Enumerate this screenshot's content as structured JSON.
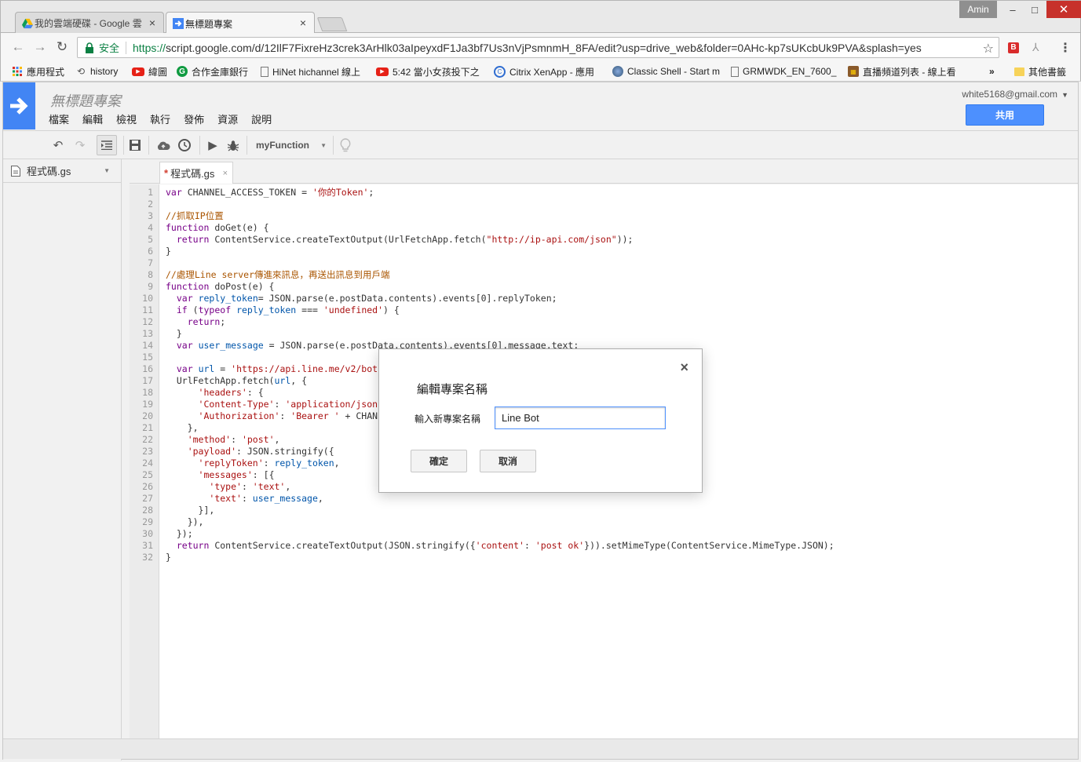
{
  "browser": {
    "tabs": [
      {
        "title": "我的雲端硬碟 - Google 雲",
        "close": "×"
      },
      {
        "title": "無標題專案",
        "close": "×"
      }
    ],
    "user_badge": "Amin",
    "window_buttons": {
      "minimize": "–",
      "maximize": "□",
      "close": "✕"
    },
    "secure_label": "安全",
    "url_scheme": "https://",
    "url_rest": "script.google.com/d/12IlF7FixreHz3crek3ArHlk03aIpeyxdF1Ja3bf7Us3nVjPsmnmH_8FA/edit?usp=drive_web&folder=0AHc-kp7sUKcbUk9PVA&splash=yes",
    "bookmarks": [
      {
        "label": "應用程式",
        "icon": "apps-grid-icon"
      },
      {
        "label": "history",
        "icon": "history-icon"
      },
      {
        "label": "緯圖",
        "icon": "youtube-icon"
      },
      {
        "label": "合作金庫銀行",
        "icon": "bank-icon"
      },
      {
        "label": "HiNet hichannel 線上",
        "icon": "page-icon"
      },
      {
        "label": "5:42 當小女孩投下之",
        "icon": "youtube-icon"
      },
      {
        "label": "Citrix XenApp - 應用",
        "icon": "citrix-icon"
      },
      {
        "label": "Classic Shell - Start m",
        "icon": "shell-icon"
      },
      {
        "label": "GRMWDK_EN_7600_",
        "icon": "page-icon"
      },
      {
        "label": "直播頻道列表 - 線上看",
        "icon": "tv-icon"
      }
    ],
    "bookmarks_more": "»",
    "other_bookmarks": "其他書籤"
  },
  "app": {
    "project_title": "無標題專案",
    "menu": [
      "檔案",
      "編輯",
      "檢視",
      "執行",
      "發佈",
      "資源",
      "說明"
    ],
    "account": "white5168@gmail.com",
    "share_label": "共用",
    "function_select": "myFunction",
    "file_name": "程式碼.gs",
    "tab_dirty": "*",
    "tab_name": "程式碼.gs",
    "tab_close": "×"
  },
  "code_lines": [
    "var CHANNEL_ACCESS_TOKEN = '你的Token';",
    "",
    "//抓取IP位置",
    "function doGet(e) {",
    "  return ContentService.createTextOutput(UrlFetchApp.fetch(\"http://ip-api.com/json\"));",
    "}",
    "",
    "//處理Line server傳進來訊息，再送出訊息到用戶端",
    "function doPost(e) {",
    "  var reply_token= JSON.parse(e.postData.contents).events[0].replyToken;",
    "  if (typeof reply_token === 'undefined') {",
    "    return;",
    "  }",
    "  var user_message = JSON.parse(e.postData.contents).events[0].message.text;",
    "",
    "  var url = 'https://api.line.me/v2/bot",
    "  UrlFetchApp.fetch(url, {",
    "      'headers': {",
    "      'Content-Type': 'application/json",
    "      'Authorization': 'Bearer ' + CHAN",
    "    },",
    "    'method': 'post',",
    "    'payload': JSON.stringify({",
    "      'replyToken': reply_token,",
    "      'messages': [{",
    "        'type': 'text',",
    "        'text': user_message,",
    "      }],",
    "    }),",
    "  });",
    "  return ContentService.createTextOutput(JSON.stringify({'content': 'post ok'})).setMimeType(ContentService.MimeType.JSON);",
    "}"
  ],
  "dialog": {
    "title": "編輯專案名稱",
    "label": "輸入新專案名稱",
    "input_value": "Line Bot",
    "ok_label": "確定",
    "cancel_label": "取消",
    "close": "×"
  }
}
